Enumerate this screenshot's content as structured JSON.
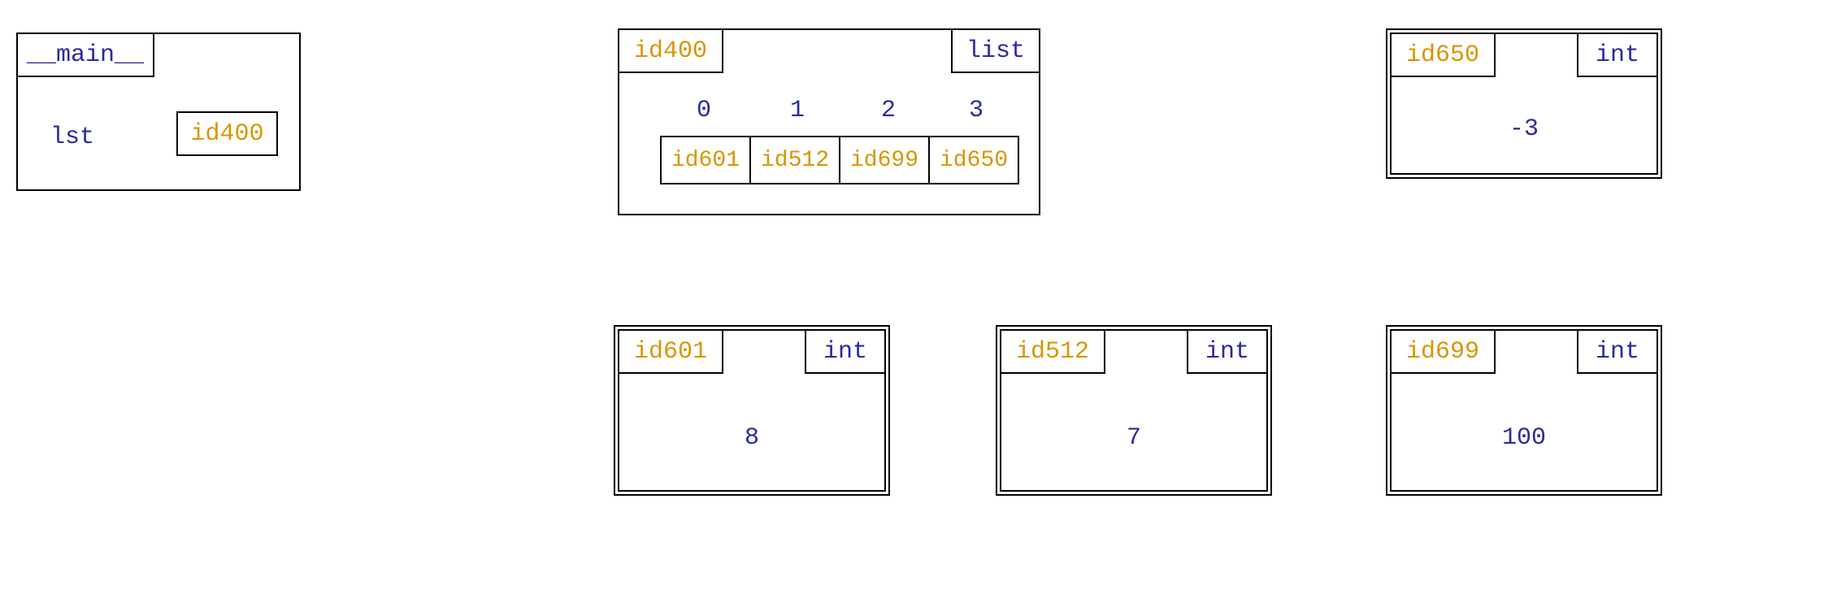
{
  "frame": {
    "label": "__main__",
    "var_name": "lst",
    "var_ref": "id400"
  },
  "list_obj": {
    "id": "id400",
    "type": "list",
    "indices": [
      "0",
      "1",
      "2",
      "3"
    ],
    "refs": [
      "id601",
      "id512",
      "id699",
      "id650"
    ]
  },
  "int_objects": [
    {
      "id": "id650",
      "type": "int",
      "value": "-3"
    },
    {
      "id": "id601",
      "type": "int",
      "value": "8"
    },
    {
      "id": "id512",
      "type": "int",
      "value": "7"
    },
    {
      "id": "id699",
      "type": "int",
      "value": "100"
    }
  ]
}
